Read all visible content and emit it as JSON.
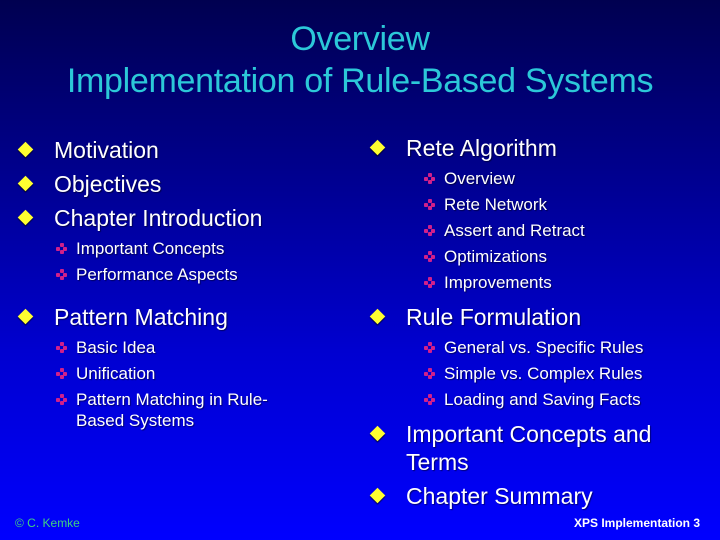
{
  "slide": {
    "title_line1": "Overview",
    "title_line2": "Implementation of Rule-Based Systems",
    "colors": {
      "title": "#2cc8d8",
      "bullet": "#ffff30",
      "sub_bullet": "#d0208a",
      "footer_left": "#40d080",
      "background_top": "#000050",
      "background_bottom": "#0000ff"
    },
    "left_column": [
      {
        "label": "Motivation",
        "icon": "yellow-diamond-bullet",
        "children": []
      },
      {
        "label": "Objectives",
        "icon": "yellow-diamond-bullet",
        "children": []
      },
      {
        "label": "Chapter Introduction",
        "icon": "yellow-diamond-bullet",
        "children": [
          "Important Concepts",
          "Performance Aspects"
        ]
      },
      {
        "label": "Pattern Matching",
        "icon": "yellow-diamond-bullet",
        "children": [
          "Basic Idea",
          "Unification",
          "Pattern Matching in Rule-Based Systems"
        ]
      }
    ],
    "right_column": [
      {
        "label": "Rete Algorithm",
        "icon": "yellow-diamond-bullet",
        "children": [
          "Overview",
          "Rete Network",
          "Assert and Retract",
          "Optimizations",
          "Improvements"
        ]
      },
      {
        "label": "Rule Formulation",
        "icon": "yellow-diamond-bullet",
        "children": [
          "General vs. Specific Rules",
          "Simple vs. Complex Rules",
          "Loading and Saving Facts"
        ]
      },
      {
        "label": "Important Concepts and Terms",
        "icon": "yellow-diamond-bullet",
        "children": []
      },
      {
        "label": "Chapter Summary",
        "icon": "yellow-diamond-bullet",
        "children": []
      }
    ],
    "footer_left": "© C. Kemke",
    "footer_right": "XPS Implementation 3"
  }
}
